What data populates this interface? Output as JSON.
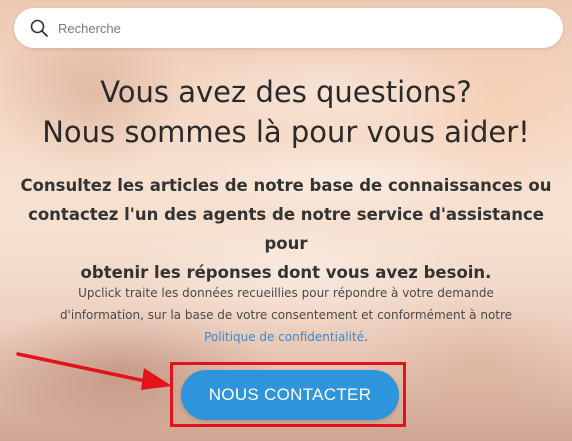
{
  "search": {
    "placeholder": "Recherche",
    "icon": "search-icon"
  },
  "hero": {
    "headline_line1": "Vous avez des questions?",
    "headline_line2": "Nous sommes là pour vous aider!",
    "subhead_line1": "Consultez les articles de notre base de connaissances ou",
    "subhead_line2": "contactez l'un des agents de notre service d'assistance pour",
    "subhead_line3": "obtenir les réponses dont vous avez besoin.",
    "legal_line1": "Upclick traite les données recueillies pour répondre à votre demande",
    "legal_line2": "d'information, sur la base de votre consentement et conformément à notre",
    "legal_link": "Politique de confidentialité",
    "legal_end": "."
  },
  "contact_button": {
    "label": "NOUS CONTACTER"
  },
  "annotation": {
    "arrow_icon": "arrow-right-icon",
    "highlight_color": "#e3131b"
  },
  "colors": {
    "accent": "#2e94db",
    "link": "#3a8bd0",
    "annotation": "#e3131b"
  }
}
